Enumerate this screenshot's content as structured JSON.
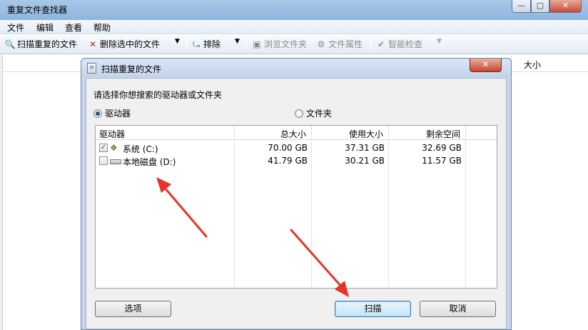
{
  "window": {
    "title": "重复文件查找器",
    "controls": {
      "minimize": "—",
      "maximize": "▢",
      "close": "✕"
    }
  },
  "menu": [
    "文件",
    "编辑",
    "查看",
    "帮助"
  ],
  "toolbar": {
    "scan_label": "扫描重复的文件",
    "delete_label": "删除选中的文件",
    "exclude_label": "排除",
    "browse_label": "浏览文件夹",
    "properties_label": "文件属性",
    "smart_check_label": "智能检查"
  },
  "main": {
    "size_column": "大小"
  },
  "dialog": {
    "title": "扫描重复的文件",
    "close": "✕",
    "prompt": "请选择你想搜索的驱动器或文件夹",
    "radio_drive": "驱动器",
    "radio_folder": "文件夹",
    "selected_radio": "drive",
    "columns": [
      "驱动器",
      "总大小",
      "使用大小",
      "剩余空间"
    ],
    "drives": [
      {
        "name": "系统 (C:)",
        "checked": true,
        "total": "70.00 GB",
        "used": "37.31 GB",
        "free": "32.69 GB"
      },
      {
        "name": "本地磁盘 (D:)",
        "checked": false,
        "total": "41.79 GB",
        "used": "30.21 GB",
        "free": "11.57 GB"
      }
    ],
    "buttons": {
      "options": "选项",
      "scan": "扫描",
      "cancel": "取消"
    }
  },
  "colors": {
    "annotation_arrow": "#e8332a",
    "title_bar": "#9fc0e4",
    "close_button": "#c84a33"
  }
}
